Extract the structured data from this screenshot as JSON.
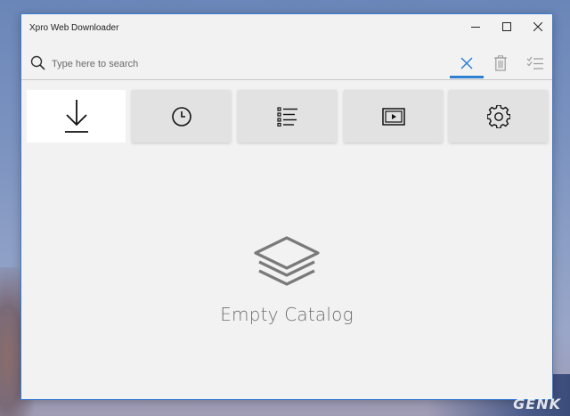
{
  "window": {
    "title": "Xpro Web Downloader",
    "controls": [
      "minimize-icon",
      "maximize-icon",
      "close-icon"
    ]
  },
  "search": {
    "placeholder": "Type here to search",
    "value": ""
  },
  "toolbar": {
    "buttons": [
      {
        "icon": "clear-icon",
        "active": true
      },
      {
        "icon": "trash-icon",
        "active": false
      },
      {
        "icon": "select-all-icon",
        "active": false
      }
    ]
  },
  "tabs": [
    {
      "icon": "download-icon",
      "selected": true
    },
    {
      "icon": "history-icon",
      "selected": false
    },
    {
      "icon": "list-icon",
      "selected": false
    },
    {
      "icon": "video-icon",
      "selected": false
    },
    {
      "icon": "settings-icon",
      "selected": false
    }
  ],
  "main": {
    "empty_label": "Empty Catalog",
    "empty_icon": "layers-icon"
  },
  "watermark": "GENK",
  "colors": {
    "accent": "#2d7fd3",
    "window_bg": "#f2f2f2",
    "tab_bg": "#e2e2e2",
    "tab_selected_bg": "#ffffff",
    "muted_text": "#6e6e6e"
  }
}
